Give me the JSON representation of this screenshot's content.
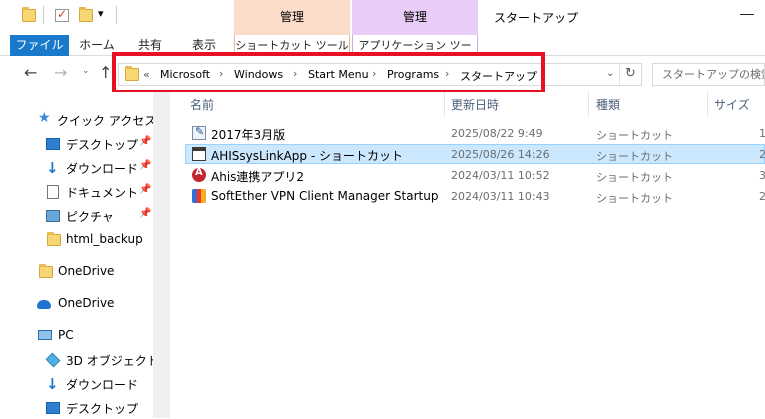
{
  "titlebar": {
    "title": "スタートアップ",
    "context_tab_1": "管理",
    "context_tab_2": "管理",
    "context_color_1": "#fcdccb",
    "context_color_2": "#e8cdf6"
  },
  "ribbon": {
    "tabs": [
      "ファイル",
      "ホーム",
      "共有",
      "表示",
      "ショートカット ツール",
      "アプリケーション ツール"
    ]
  },
  "address": {
    "prefix": "«",
    "crumbs": [
      "Microsoft",
      "Windows",
      "Start Menu",
      "Programs",
      "スタートアップ"
    ],
    "separator": "›",
    "dropdown_icon": "chevron-down-icon",
    "refresh_icon": "refresh-icon"
  },
  "search": {
    "placeholder": "スタートアップの検索"
  },
  "navpane": {
    "quick_access": "クイック アクセス",
    "items": [
      {
        "label": "デスクトップ",
        "icon": "desktop-icon",
        "pinned": true
      },
      {
        "label": "ダウンロード",
        "icon": "download-icon",
        "pinned": true
      },
      {
        "label": "ドキュメント",
        "icon": "document-icon",
        "pinned": true
      },
      {
        "label": "ピクチャ",
        "icon": "picture-icon",
        "pinned": true
      },
      {
        "label": "html_backup",
        "icon": "folder-icon",
        "pinned": false
      }
    ],
    "onedrive_1": "OneDrive",
    "onedrive_2": "OneDrive",
    "pc": "PC",
    "pc_items": [
      {
        "label": "3D オブジェクト",
        "icon": "3d-objects-icon"
      },
      {
        "label": "ダウンロード",
        "icon": "download-icon"
      },
      {
        "label": "デスクトップ",
        "icon": "desktop-icon"
      }
    ]
  },
  "filelist": {
    "columns": [
      "名前",
      "更新日時",
      "種類",
      "サイズ"
    ],
    "rows": [
      {
        "name": "2017年3月版",
        "date": "2025/08/22 9:49",
        "type": "ショートカット",
        "size": "1",
        "icon": "shortcut-app-icon",
        "selected": false
      },
      {
        "name": "AHISsysLinkApp - ショートカット",
        "date": "2025/08/26 14:26",
        "type": "ショートカット",
        "size": "2",
        "icon": "window-app-icon",
        "selected": true
      },
      {
        "name": "Ahis連携アプリ2",
        "date": "2024/03/11 10:52",
        "type": "ショートカット",
        "size": "3",
        "icon": "ahis-app-icon",
        "selected": false
      },
      {
        "name": "SoftEther VPN Client Manager Startup",
        "date": "2024/03/11 10:43",
        "type": "ショートカット",
        "size": "2",
        "icon": "vpn-app-icon",
        "selected": false
      }
    ]
  },
  "highlight_color": "#e81123"
}
